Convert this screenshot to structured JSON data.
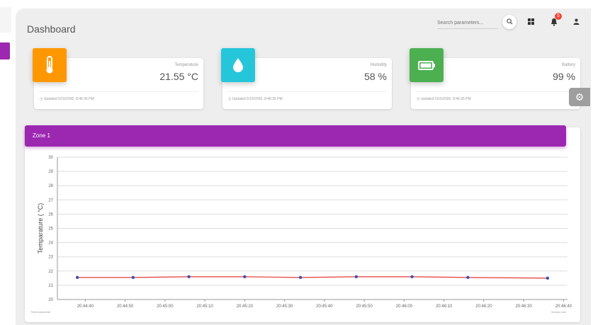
{
  "page": {
    "title": "Dashboard"
  },
  "search": {
    "placeholder": "Search parameters..."
  },
  "icons": {
    "search": "search-icon",
    "apps": "apps-icon",
    "notifications": "notifications-icon",
    "user": "user-icon",
    "settings": "gear-icon"
  },
  "notifications": {
    "count": "5"
  },
  "cards": [
    {
      "label": "Temperature",
      "value": "21.55 °C",
      "footer": "Updated 5/15/2020, 8:46:35 PM",
      "icon": "thermometer-icon",
      "color": "#ff9800"
    },
    {
      "label": "Humidity",
      "value": "58 %",
      "footer": "Updated 5/15/2020, 8:46:35 PM",
      "icon": "water-drop-icon",
      "color": "#26c6da"
    },
    {
      "label": "Battery",
      "value": "99 %",
      "footer": "Updated 5/15/2020, 8:46:35 PM",
      "icon": "battery-icon",
      "color": "#4caf50"
    }
  ],
  "chart": {
    "header": "Zone 1"
  },
  "chart_data": {
    "type": "line",
    "title": "Zone 1",
    "ylabel": "Temparature ( °C)",
    "xlabel_left": "Thermodometer",
    "xlabel_right": "Sensor.com",
    "ylim": [
      20,
      30
    ],
    "yticks": [
      "30",
      "29",
      "28",
      "27",
      "26",
      "25",
      "24",
      "23",
      "22",
      "21",
      "20"
    ],
    "xticks": [
      "20:44:40",
      "20:44:50",
      "20:45:00",
      "20:45:10",
      "20:45:20",
      "20:45:30",
      "20:45:40",
      "20:45:50",
      "20:46:00",
      "20:46:10",
      "20:46:20",
      "20:46:30",
      "20:46:40"
    ],
    "series": [
      {
        "color": "#e53935",
        "point_color": "#3f51b5",
        "x": [
          "20:44:38",
          "20:44:52",
          "20:45:06",
          "20:45:20",
          "20:45:34",
          "20:45:48",
          "20:46:02",
          "20:46:16",
          "20:46:36"
        ],
        "values": [
          21.55,
          21.55,
          21.6,
          21.6,
          21.55,
          21.6,
          21.6,
          21.55,
          21.5
        ]
      }
    ],
    "grid": true
  }
}
